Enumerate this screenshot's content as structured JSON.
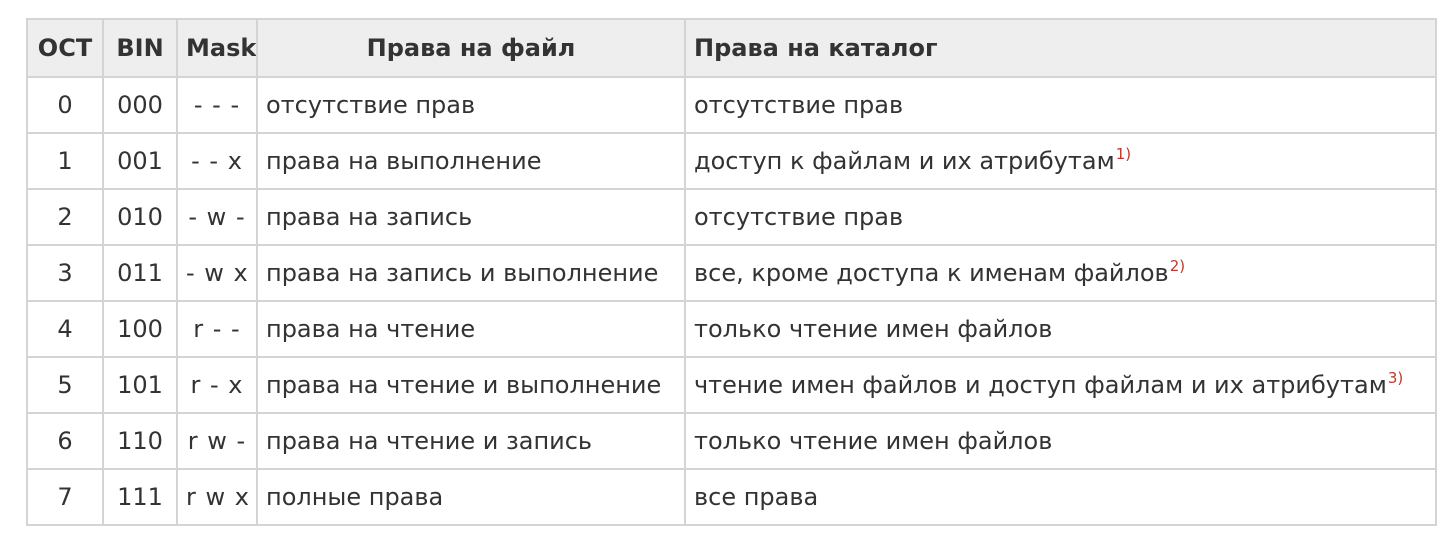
{
  "table": {
    "headers": {
      "oct": "OCT",
      "bin": "BIN",
      "mask": "Mask",
      "file": "Права на файл",
      "dir": "Права на каталог"
    },
    "rows": [
      {
        "oct": "0",
        "bin": "000",
        "mask": "- - -",
        "file": "отсутствие прав",
        "dir": "отсутствие прав",
        "note": ""
      },
      {
        "oct": "1",
        "bin": "001",
        "mask": "- - x",
        "file": "права на выполнение",
        "dir": "доступ к файлам и их атрибутам",
        "note": "1)"
      },
      {
        "oct": "2",
        "bin": "010",
        "mask": "- w -",
        "file": "права на запись",
        "dir": "отсутствие прав",
        "note": ""
      },
      {
        "oct": "3",
        "bin": "011",
        "mask": "- w x",
        "file": "права на запись и выполнение",
        "dir": "все, кроме доступа к именам файлов",
        "note": "2)"
      },
      {
        "oct": "4",
        "bin": "100",
        "mask": "r - -",
        "file": "права на чтение",
        "dir": "только чтение имен файлов",
        "note": ""
      },
      {
        "oct": "5",
        "bin": "101",
        "mask": "r - x",
        "file": "права на чтение и выполнение",
        "dir": "чтение имен файлов и доступ файлам и их атрибутам",
        "note": "3)"
      },
      {
        "oct": "6",
        "bin": "110",
        "mask": "r w -",
        "file": "права на чтение и запись",
        "dir": "только чтение имен файлов",
        "note": ""
      },
      {
        "oct": "7",
        "bin": "111",
        "mask": "r w x",
        "file": "полные права",
        "dir": "все права",
        "note": ""
      }
    ]
  }
}
